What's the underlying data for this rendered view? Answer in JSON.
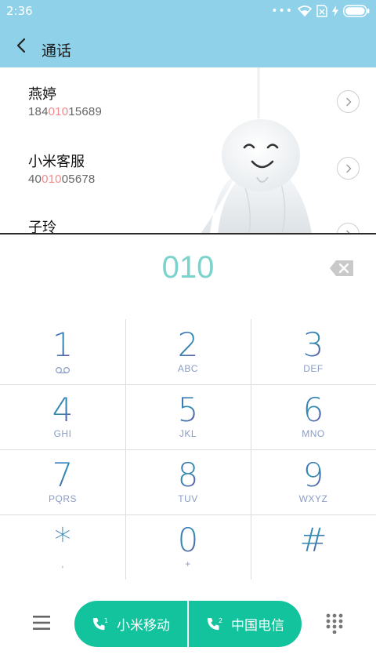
{
  "status_bar": {
    "time": "2:36",
    "more_icon": "ellipsis-icon",
    "wifi_icon": "wifi-icon",
    "sim_icon": "no-sim-icon",
    "charging_icon": "lightning-icon",
    "battery_icon": "battery-icon",
    "battery_level": 1.0
  },
  "header": {
    "back_icon": "chevron-left-icon",
    "title": "通话"
  },
  "results": [
    {
      "name": "燕婷",
      "number_prefix": "184",
      "number_match": "010",
      "number_suffix": "15689"
    },
    {
      "name": "小米客服",
      "number_prefix": "40",
      "number_match": "010",
      "number_suffix": "05678"
    },
    {
      "name": "子玲",
      "number_prefix": "",
      "number_match": "",
      "number_suffix": ""
    }
  ],
  "dialer": {
    "input": "010",
    "backspace_icon": "backspace-icon"
  },
  "keypad": {
    "keys": [
      {
        "digit": "1",
        "letters": "",
        "sub_icon": "voicemail-icon"
      },
      {
        "digit": "2",
        "letters": "ABC"
      },
      {
        "digit": "3",
        "letters": "DEF"
      },
      {
        "digit": "4",
        "letters": "GHI"
      },
      {
        "digit": "5",
        "letters": "JKL"
      },
      {
        "digit": "6",
        "letters": "MNO"
      },
      {
        "digit": "7",
        "letters": "PQRS"
      },
      {
        "digit": "8",
        "letters": "TUV"
      },
      {
        "digit": "9",
        "letters": "WXYZ"
      },
      {
        "digit": "*",
        "letters": ","
      },
      {
        "digit": "0",
        "letters": "+"
      },
      {
        "digit": "#",
        "letters": ""
      }
    ]
  },
  "bottom_bar": {
    "menu_icon": "menu-icon",
    "sim1_label": "小米移动",
    "sim1_icon": "phone-sim1-icon",
    "sim2_label": "中国电信",
    "sim2_icon": "phone-sim2-icon",
    "keypad_toggle_icon": "dialpad-icon",
    "accent_color": "#13c39d"
  },
  "colors": {
    "header_bg": "#8ed1e8",
    "match_highlight": "#f08b8b",
    "dialed_text": "#7bd3cc"
  }
}
